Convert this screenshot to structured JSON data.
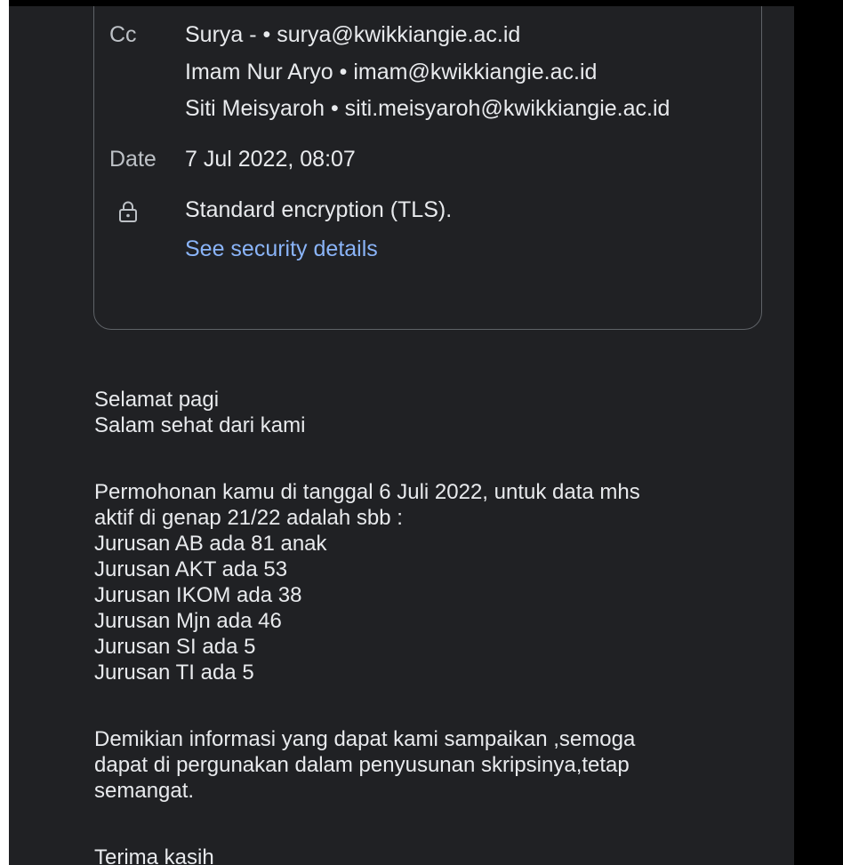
{
  "details": {
    "cc_label": "Cc",
    "cc_recipients": [
      {
        "name": "Surya -",
        "email": "surya@kwikkiangie.ac.id"
      },
      {
        "name": "Imam Nur Aryo",
        "email": "imam@kwikkiangie.ac.id"
      },
      {
        "name": "Siti Meisyaroh",
        "email": "siti.meisyaroh@kwikkiangie.ac.id"
      }
    ],
    "cc_line_0": "Surya - • surya@kwikkiangie.ac.id",
    "cc_line_1": "Imam Nur Aryo • imam@kwikkiangie.ac.id",
    "cc_line_2": "Siti Meisyaroh • siti.meisyaroh@kwikkiangie.ac.id",
    "date_label": "Date",
    "date_value": "7 Jul 2022, 08:07",
    "security_icon": "lock-icon",
    "security_text": "Standard encryption (TLS).",
    "security_link": "See security details"
  },
  "message": {
    "lines": [
      "Selamat pagi",
      "Salam sehat dari kami",
      "Permohonan kamu di tanggal 6 Juli 2022, untuk data mhs",
      "aktif di genap 21/22 adalah sbb :",
      "Jurusan AB ada 81 anak",
      "Jurusan AKT ada 53",
      "Jurusan IKOM ada 38",
      "Jurusan Mjn ada 46",
      "Jurusan SI ada 5",
      "Jurusan TI ada 5",
      "Demikian informasi yang dapat kami sampaikan ,semoga",
      "dapat di pergunakan dalam penyusunan skripsinya,tetap",
      "semangat.",
      "Terima kasih"
    ]
  },
  "colors": {
    "background": "#202124",
    "text": "#e8eaed",
    "link": "#8ab4f8",
    "border": "#5f6368"
  }
}
